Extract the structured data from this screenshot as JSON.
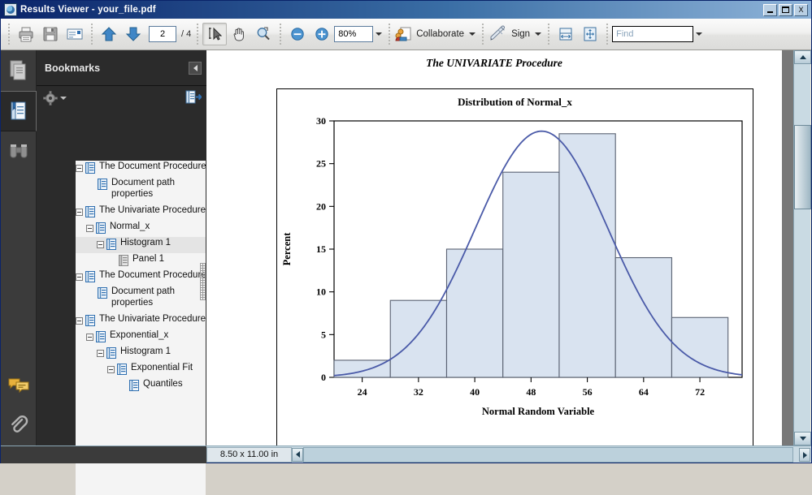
{
  "window": {
    "title": "Results Viewer - your_file.pdf",
    "app_icon": "adobe-reader-icon",
    "minimize_label": "_",
    "maximize_label": "",
    "close_label": "X"
  },
  "toolbar": {
    "print_label": "print-icon",
    "save_label": "save-icon",
    "email_label": "email-icon",
    "prev_page_label": "previous-page-icon",
    "next_page_label": "next-page-icon",
    "page_number": "2",
    "page_total": "/ 4",
    "select_tool_label": "select-tool-icon",
    "hand_tool_label": "hand-tool-icon",
    "marquee_zoom_label": "marquee-zoom-icon",
    "zoom_out_label": "zoom-out-icon",
    "zoom_in_label": "zoom-in-icon",
    "zoom_value": "80%",
    "collaborate_label": "Collaborate",
    "sign_label": "Sign",
    "fit_width_label": "fit-width-icon",
    "fit_page_label": "fit-page-icon",
    "find_placeholder": "Find"
  },
  "rail": {
    "items": [
      {
        "name": "pages-panel-icon",
        "selected": false
      },
      {
        "name": "bookmarks-panel-icon",
        "selected": true
      },
      {
        "name": "search-panel-icon",
        "selected": false
      }
    ],
    "bottom_items": [
      {
        "name": "comments-panel-icon"
      },
      {
        "name": "attachments-panel-icon"
      }
    ]
  },
  "bookmarks": {
    "title": "Bookmarks",
    "collapse_label": "collapse-panel-icon",
    "options_label": "options-gear-icon",
    "new_bookmark_label": "new-bookmark-icon",
    "tree": [
      {
        "label": "The Document Procedure",
        "depth": 0,
        "expandable": true,
        "selected": false,
        "wrap": false,
        "dim": false
      },
      {
        "label": "Document path properties",
        "depth": 1,
        "expandable": false,
        "selected": false,
        "wrap": true,
        "dim": false
      },
      {
        "label": "The Univariate Procedure",
        "depth": 0,
        "expandable": true,
        "selected": false,
        "wrap": false,
        "dim": false
      },
      {
        "label": "Normal_x",
        "depth": 1,
        "expandable": true,
        "selected": false,
        "wrap": false,
        "dim": false
      },
      {
        "label": "Histogram 1",
        "depth": 2,
        "expandable": true,
        "selected": true,
        "wrap": false,
        "dim": false
      },
      {
        "label": "Panel 1",
        "depth": 3,
        "expandable": false,
        "selected": false,
        "wrap": false,
        "dim": true
      },
      {
        "label": "The Document Procedure",
        "depth": 0,
        "expandable": true,
        "selected": false,
        "wrap": false,
        "dim": false
      },
      {
        "label": "Document path properties",
        "depth": 1,
        "expandable": false,
        "selected": false,
        "wrap": true,
        "dim": false
      },
      {
        "label": "The Univariate Procedure",
        "depth": 0,
        "expandable": true,
        "selected": false,
        "wrap": false,
        "dim": false
      },
      {
        "label": "Exponential_x",
        "depth": 1,
        "expandable": true,
        "selected": false,
        "wrap": false,
        "dim": false
      },
      {
        "label": "Histogram 1",
        "depth": 2,
        "expandable": true,
        "selected": false,
        "wrap": false,
        "dim": false
      },
      {
        "label": "Exponential Fit",
        "depth": 3,
        "expandable": true,
        "selected": false,
        "wrap": false,
        "dim": false
      },
      {
        "label": "Quantiles",
        "depth": 4,
        "expandable": false,
        "selected": false,
        "wrap": false,
        "dim": false
      }
    ]
  },
  "document": {
    "procedure_title": "The UNIVARIATE Procedure"
  },
  "status": {
    "page_size": "8.50 x 11.00 in"
  },
  "chart_data": {
    "type": "bar",
    "title": "Distribution of Normal_x",
    "xlabel": "Normal Random Variable",
    "ylabel": "Percent",
    "xlim": [
      20,
      78
    ],
    "ylim": [
      0,
      30
    ],
    "ytick_values": [
      0,
      5,
      10,
      15,
      20,
      25,
      30
    ],
    "ytick_labels": [
      "0",
      "5",
      "10",
      "15",
      "20",
      "25",
      "30"
    ],
    "xtick_values": [
      24,
      32,
      40,
      48,
      56,
      64,
      72
    ],
    "xtick_labels": [
      "24",
      "32",
      "40",
      "48",
      "56",
      "64",
      "72"
    ],
    "bin_edges": [
      20,
      28,
      36,
      44,
      52,
      60,
      68,
      76
    ],
    "bin_centers": [
      24,
      32,
      40,
      48,
      56,
      64,
      72
    ],
    "values": [
      2,
      9,
      15,
      24,
      28.5,
      14,
      7
    ],
    "bar_fill": "#d9e3f0",
    "bar_stroke": "#5a6272",
    "grid": false,
    "legend": null,
    "series": [
      {
        "name": "Normal density curve",
        "type": "line",
        "color": "#4a5aa8",
        "mu": 49.5,
        "sigma": 9.4,
        "peak_percent": 28.8
      }
    ]
  }
}
